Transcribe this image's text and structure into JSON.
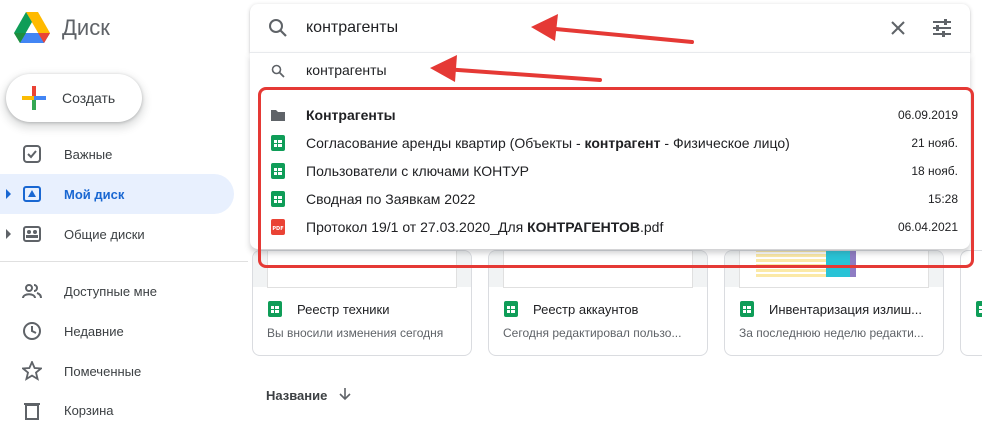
{
  "app": {
    "name": "Диск"
  },
  "sidebar": {
    "create_label": "Создать",
    "items": [
      {
        "label": "Важные",
        "icon": "checkbox-icon"
      },
      {
        "label": "Мой диск",
        "icon": "drive-icon"
      },
      {
        "label": "Общие диски",
        "icon": "shared-drives-icon"
      },
      {
        "label": "Доступные мне",
        "icon": "people-icon"
      },
      {
        "label": "Недавние",
        "icon": "clock-icon"
      },
      {
        "label": "Помеченные",
        "icon": "star-icon"
      },
      {
        "label": "Корзина",
        "icon": "trash-icon"
      }
    ]
  },
  "search": {
    "value": "контрагенты",
    "suggestion": "контрагенты"
  },
  "results": [
    {
      "name": "Контрагенты",
      "date": "06.09.2019",
      "type": "folder"
    },
    {
      "name_pre": "Согласование аренды квартир (Объекты - ",
      "name_bold": "контрагент",
      "name_post": " - Физическое лицо)",
      "date": "21 нояб.",
      "type": "sheet"
    },
    {
      "name": "Пользователи с ключами КОНТУР",
      "date": "18 нояб.",
      "type": "sheet"
    },
    {
      "name": "Сводная по Заявкам 2022",
      "date": "15:28",
      "type": "sheet"
    },
    {
      "name_pre": "Протокол 19/1 от 27.03.2020_Для ",
      "name_bold": "КОНТРАГЕНТОВ",
      "name_post": ".pdf",
      "date": "06.04.2021",
      "type": "pdf"
    }
  ],
  "cards": [
    {
      "title": "Реестр техники",
      "sub": "Вы вносили изменения сегодня"
    },
    {
      "title": "Реестр аккаунтов",
      "sub": "Сегодня редактировал пользо..."
    },
    {
      "title": "Инвентаризация излиш...",
      "sub": "За последнюю неделю редакти..."
    }
  ],
  "list_header": {
    "sort_label": "Название"
  },
  "colors": {
    "accent": "#1967d2",
    "annotation": "#e53935",
    "sheet": "#0f9d58",
    "pdf": "#ea4335"
  }
}
